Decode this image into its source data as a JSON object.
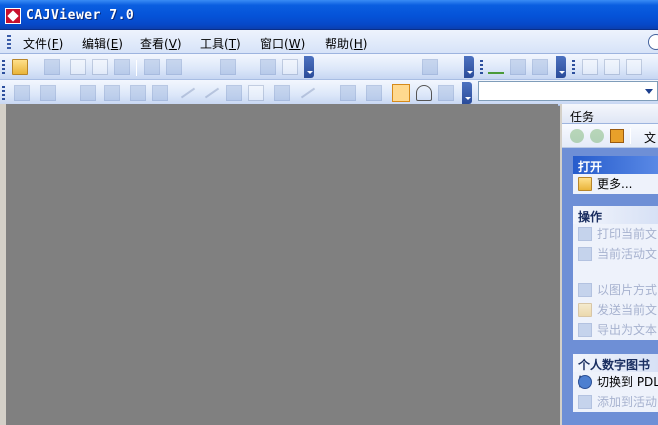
{
  "window": {
    "title": "CAJViewer 7.0"
  },
  "menu": [
    {
      "label": "文件(",
      "key": "F",
      "tail": ")"
    },
    {
      "label": "编辑(",
      "key": "E",
      "tail": ")"
    },
    {
      "label": "查看(",
      "key": "V",
      "tail": ")"
    },
    {
      "label": "工具(",
      "key": "T",
      "tail": ")"
    },
    {
      "label": "窗口(",
      "key": "W",
      "tail": ")"
    },
    {
      "label": "帮助(",
      "key": "H",
      "tail": ")"
    }
  ],
  "task_pane": {
    "title": "任务",
    "nav_text": "文",
    "sections": [
      {
        "heading": "打开",
        "items": [
          {
            "label": "更多...",
            "icon": "folder-icon",
            "enabled": true
          }
        ]
      },
      {
        "heading": "操作",
        "items": [
          {
            "label": "打印当前文",
            "icon": "printer-icon",
            "enabled": false
          },
          {
            "label": "当前活动文",
            "icon": "save-icon",
            "enabled": false
          },
          {
            "label": "",
            "icon": "",
            "enabled": false
          },
          {
            "label": "以图片方式",
            "icon": "image-icon",
            "enabled": false
          },
          {
            "label": "发送当前文",
            "icon": "mail-icon",
            "enabled": false
          },
          {
            "label": "导出为文本",
            "icon": "export-icon",
            "enabled": false
          }
        ]
      },
      {
        "heading": "个人数字图书馆",
        "items": [
          {
            "label": "切换到 PDL",
            "icon": "switch-icon",
            "enabled": true
          },
          {
            "label": "添加到活动",
            "icon": "library-icon",
            "enabled": false
          }
        ]
      }
    ]
  },
  "colors": {
    "title_bar": "#0553d8",
    "workspace": "#808080",
    "task_pane_bg": "#6e8fd6"
  }
}
